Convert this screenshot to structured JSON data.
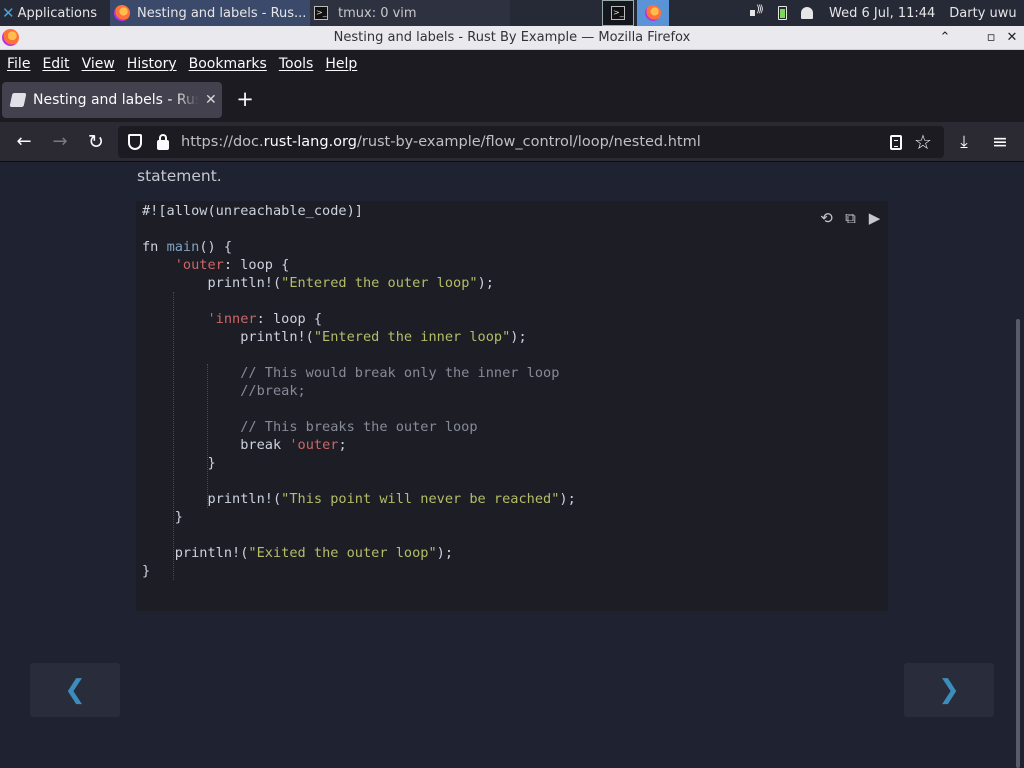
{
  "taskbar": {
    "applications_label": "Applications",
    "tasks": [
      {
        "label": "Nesting and labels - Rus...",
        "icon": "firefox-icon"
      },
      {
        "label": "tmux: 0 vim",
        "icon": "terminal-icon"
      }
    ],
    "clock": "Wed  6 Jul, 11:44",
    "user": "Darty uwu"
  },
  "window": {
    "title": "Nesting and labels - Rust By Example — Mozilla Firefox"
  },
  "menu": {
    "items": [
      "File",
      "Edit",
      "View",
      "History",
      "Bookmarks",
      "Tools",
      "Help"
    ]
  },
  "tabs": {
    "active_title": "Nesting and labels - Rust By Example",
    "close_glyph": "✕",
    "new_tab_glyph": "+"
  },
  "toolbar": {
    "url_prefix": "https://doc.",
    "url_domain": "rust-lang.org",
    "url_path": "/rust-by-example/flow_control/loop/nested.html"
  },
  "page": {
    "lead_text": "statement.",
    "code_tools": [
      "⟲",
      "⧉",
      "▶"
    ],
    "prev_glyph": "❮",
    "next_glyph": "❯"
  },
  "code_lines": [
    [
      {
        "t": "#![allow(unreachable_code)]",
        "c": "k"
      }
    ],
    [],
    [
      {
        "t": "fn ",
        "c": "k"
      },
      {
        "t": "main",
        "c": "f"
      },
      {
        "t": "() {",
        "c": "k"
      }
    ],
    [
      {
        "t": "    ",
        "c": "k"
      },
      {
        "t": "'outer",
        "c": "lbl"
      },
      {
        "t": ": loop {",
        "c": "k"
      }
    ],
    [
      {
        "t": "        println!(",
        "c": "k"
      },
      {
        "t": "\"Entered the outer loop\"",
        "c": "s"
      },
      {
        "t": ");",
        "c": "k"
      }
    ],
    [],
    [
      {
        "t": "        ",
        "c": "k"
      },
      {
        "t": "'inner",
        "c": "lbl"
      },
      {
        "t": ": loop {",
        "c": "k"
      }
    ],
    [
      {
        "t": "            println!(",
        "c": "k"
      },
      {
        "t": "\"Entered the inner loop\"",
        "c": "s"
      },
      {
        "t": ");",
        "c": "k"
      }
    ],
    [],
    [
      {
        "t": "            // This would break only the inner loop",
        "c": "c"
      }
    ],
    [
      {
        "t": "            //break;",
        "c": "c"
      }
    ],
    [],
    [
      {
        "t": "            // This breaks the outer loop",
        "c": "c"
      }
    ],
    [
      {
        "t": "            break ",
        "c": "k"
      },
      {
        "t": "'outer",
        "c": "lbl"
      },
      {
        "t": ";",
        "c": "k"
      }
    ],
    [
      {
        "t": "        }",
        "c": "k"
      }
    ],
    [],
    [
      {
        "t": "        println!(",
        "c": "k"
      },
      {
        "t": "\"This point will never be reached\"",
        "c": "s"
      },
      {
        "t": ");",
        "c": "k"
      }
    ],
    [
      {
        "t": "    }",
        "c": "k"
      }
    ],
    [],
    [
      {
        "t": "    println!(",
        "c": "k"
      },
      {
        "t": "\"Exited the outer loop\"",
        "c": "s"
      },
      {
        "t": ");",
        "c": "k"
      }
    ],
    [
      {
        "t": "}",
        "c": "k"
      }
    ]
  ]
}
